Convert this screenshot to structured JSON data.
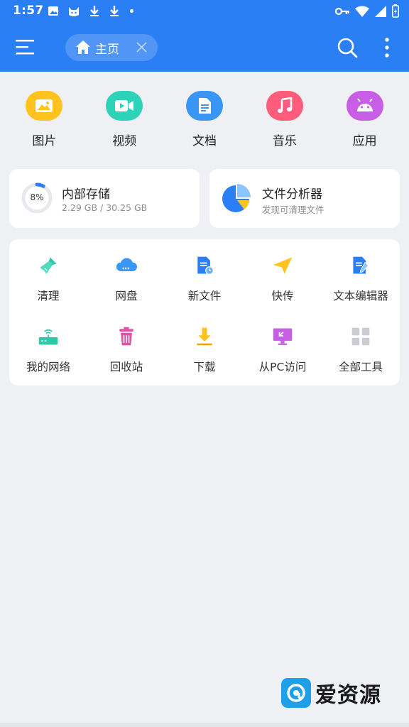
{
  "status_bar": {
    "time": "1:57"
  },
  "header": {
    "tab_label": "主页"
  },
  "categories": [
    {
      "label": "图片",
      "icon": "image-icon",
      "color": "#ffc21e"
    },
    {
      "label": "视频",
      "icon": "video-icon",
      "color": "#2dd3b8"
    },
    {
      "label": "文档",
      "icon": "document-icon",
      "color": "#3a96f5"
    },
    {
      "label": "音乐",
      "icon": "music-icon",
      "color": "#ff5c7c"
    },
    {
      "label": "应用",
      "icon": "android-icon",
      "color": "#c95ee6"
    }
  ],
  "storage": {
    "title": "内部存储",
    "usage": "2.29 GB / 30.25 GB",
    "percent_text": "8%",
    "percent": 8
  },
  "analyzer": {
    "title": "文件分析器",
    "subtitle": "发现可清理文件"
  },
  "tools": [
    {
      "label": "清理",
      "icon": "broom-icon"
    },
    {
      "label": "网盘",
      "icon": "cloud-drive-icon"
    },
    {
      "label": "新文件",
      "icon": "new-file-icon"
    },
    {
      "label": "快传",
      "icon": "paper-plane-icon"
    },
    {
      "label": "文本编辑器",
      "icon": "text-editor-icon"
    },
    {
      "label": "我的网络",
      "icon": "router-icon"
    },
    {
      "label": "回收站",
      "icon": "recycle-bin-icon"
    },
    {
      "label": "下载",
      "icon": "download-icon"
    },
    {
      "label": "从PC访问",
      "icon": "pc-access-icon"
    },
    {
      "label": "全部工具",
      "icon": "all-tools-icon"
    }
  ],
  "watermark": {
    "text": "爱资源"
  },
  "colors": {
    "primary": "#2b7ff5",
    "background": "#eef0f3",
    "card": "#ffffff"
  }
}
